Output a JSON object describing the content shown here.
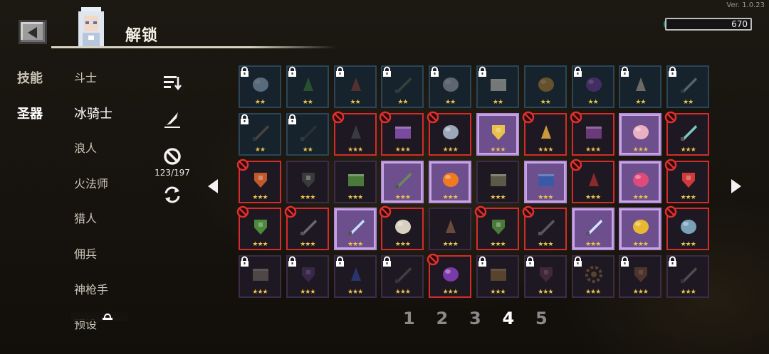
{
  "version": "Ver. 1.0.23",
  "header": {
    "title": "解锁",
    "currency_value": "670"
  },
  "left_tabs": [
    {
      "label": "技能",
      "active": false
    },
    {
      "label": "圣器",
      "active": true
    }
  ],
  "classes": [
    {
      "label": "斗士",
      "active": false
    },
    {
      "label": "冰骑士",
      "active": true
    },
    {
      "label": "浪人",
      "active": false
    },
    {
      "label": "火法师",
      "active": false
    },
    {
      "label": "猎人",
      "active": false
    },
    {
      "label": "佣兵",
      "active": false
    },
    {
      "label": "神枪手",
      "active": false
    },
    {
      "label": "预设",
      "active": false
    }
  ],
  "tools": {
    "count": "123/197"
  },
  "grid_icons": [
    [
      "crystal-icon",
      "green-stone-icon",
      "red-bag-icon",
      "dagger-icon",
      "orb-cluster-icon",
      "envelope-icon",
      "ring-icon",
      "dark-orb-icon",
      "shell-icon",
      "feather-icon"
    ],
    [
      "staff-icon",
      "whip-icon",
      "potion-icon",
      "spellbook-icon",
      "rock-icon",
      "dice-icon",
      "chalice-icon",
      "tome-icon",
      "brain-icon",
      "syringe-icon"
    ],
    [
      "shield-crest-icon",
      "cross-relic-icon",
      "leaf-scroll-icon",
      "rocket-icon",
      "fireball-icon",
      "map-icon",
      "battery-icon",
      "plant-icon",
      "egg-icon",
      "medkit-icon"
    ],
    [
      "goblin-mask-icon",
      "drill-icon",
      "ice-shard-icon",
      "moon-orb-icon",
      "feast-plate-icon",
      "cape-icon",
      "spear-icon",
      "lightning-icon",
      "gold-coin-icon",
      "cloud-icon"
    ],
    [
      "stone-tablet-icon",
      "shadow-wings-icon",
      "medal-icon",
      "scythe-icon",
      "dark-heart-icon",
      "treasure-chest-icon",
      "gauntlet-icon",
      "gear-wheel-icon",
      "pouch-icon",
      "crossbow-icon"
    ]
  ],
  "grid": [
    [
      {
        "tier": 2,
        "stars": "★★",
        "lock": true,
        "ban": false,
        "sel": false,
        "dim": true
      },
      {
        "tier": 2,
        "stars": "★★",
        "lock": true,
        "ban": false,
        "sel": false,
        "dim": true
      },
      {
        "tier": 2,
        "stars": "★★",
        "lock": true,
        "ban": false,
        "sel": false,
        "dim": true
      },
      {
        "tier": 2,
        "stars": "★★",
        "lock": true,
        "ban": false,
        "sel": false,
        "dim": true
      },
      {
        "tier": 2,
        "stars": "★★",
        "lock": true,
        "ban": false,
        "sel": false,
        "dim": true
      },
      {
        "tier": 2,
        "stars": "★★",
        "lock": true,
        "ban": false,
        "sel": false,
        "dim": true
      },
      {
        "tier": 2,
        "stars": "★★",
        "lock": false,
        "ban": false,
        "sel": false,
        "dim": true
      },
      {
        "tier": 2,
        "stars": "★★",
        "lock": true,
        "ban": false,
        "sel": false,
        "dim": true
      },
      {
        "tier": 2,
        "stars": "★★",
        "lock": true,
        "ban": false,
        "sel": false,
        "dim": true
      },
      {
        "tier": 2,
        "stars": "★★",
        "lock": true,
        "ban": false,
        "sel": false,
        "dim": true
      }
    ],
    [
      {
        "tier": 2,
        "stars": "★★",
        "lock": true,
        "ban": false,
        "sel": false,
        "dim": true
      },
      {
        "tier": 2,
        "stars": "★★",
        "lock": true,
        "ban": false,
        "sel": false,
        "dim": true
      },
      {
        "tier": 3,
        "stars": "★★★",
        "lock": false,
        "ban": true,
        "sel": false,
        "dim": false
      },
      {
        "tier": 3,
        "stars": "★★★",
        "lock": false,
        "ban": true,
        "sel": false,
        "dim": false
      },
      {
        "tier": 3,
        "stars": "★★★",
        "lock": false,
        "ban": true,
        "sel": false,
        "dim": false
      },
      {
        "tier": 3,
        "stars": "★★★",
        "lock": false,
        "ban": false,
        "sel": true,
        "dim": false
      },
      {
        "tier": 3,
        "stars": "★★★",
        "lock": false,
        "ban": true,
        "sel": false,
        "dim": false
      },
      {
        "tier": 3,
        "stars": "★★★",
        "lock": false,
        "ban": true,
        "sel": false,
        "dim": false
      },
      {
        "tier": 3,
        "stars": "★★★",
        "lock": false,
        "ban": false,
        "sel": true,
        "dim": false
      },
      {
        "tier": 3,
        "stars": "★★★",
        "lock": false,
        "ban": true,
        "sel": false,
        "dim": false
      }
    ],
    [
      {
        "tier": 3,
        "stars": "★★★",
        "lock": false,
        "ban": true,
        "sel": false,
        "dim": false
      },
      {
        "tier": 3,
        "stars": "★★★",
        "lock": false,
        "ban": false,
        "sel": false,
        "dim": false
      },
      {
        "tier": 3,
        "stars": "★★★",
        "lock": false,
        "ban": false,
        "sel": false,
        "dim": false
      },
      {
        "tier": 3,
        "stars": "★★★",
        "lock": false,
        "ban": false,
        "sel": true,
        "dim": false
      },
      {
        "tier": 3,
        "stars": "★★★",
        "lock": false,
        "ban": false,
        "sel": true,
        "dim": false
      },
      {
        "tier": 3,
        "stars": "★★★",
        "lock": false,
        "ban": false,
        "sel": false,
        "dim": false
      },
      {
        "tier": 3,
        "stars": "★★★",
        "lock": false,
        "ban": false,
        "sel": true,
        "dim": false
      },
      {
        "tier": 3,
        "stars": "★★★",
        "lock": false,
        "ban": true,
        "sel": false,
        "dim": false
      },
      {
        "tier": 3,
        "stars": "★★★",
        "lock": false,
        "ban": false,
        "sel": true,
        "dim": false
      },
      {
        "tier": 3,
        "stars": "★★★",
        "lock": false,
        "ban": true,
        "sel": false,
        "dim": false
      }
    ],
    [
      {
        "tier": 3,
        "stars": "★★★",
        "lock": false,
        "ban": true,
        "sel": false,
        "dim": false
      },
      {
        "tier": 3,
        "stars": "★★★",
        "lock": false,
        "ban": true,
        "sel": false,
        "dim": false
      },
      {
        "tier": 3,
        "stars": "★★★",
        "lock": false,
        "ban": false,
        "sel": true,
        "dim": false
      },
      {
        "tier": 3,
        "stars": "★★★",
        "lock": false,
        "ban": true,
        "sel": false,
        "dim": false
      },
      {
        "tier": 3,
        "stars": "★★★",
        "lock": false,
        "ban": false,
        "sel": false,
        "dim": false
      },
      {
        "tier": 3,
        "stars": "★★★",
        "lock": false,
        "ban": true,
        "sel": false,
        "dim": false
      },
      {
        "tier": 3,
        "stars": "★★★",
        "lock": false,
        "ban": true,
        "sel": false,
        "dim": false
      },
      {
        "tier": 3,
        "stars": "★★★",
        "lock": false,
        "ban": false,
        "sel": true,
        "dim": false
      },
      {
        "tier": 3,
        "stars": "★★★",
        "lock": false,
        "ban": false,
        "sel": true,
        "dim": false
      },
      {
        "tier": 3,
        "stars": "★★★",
        "lock": false,
        "ban": true,
        "sel": false,
        "dim": false
      }
    ],
    [
      {
        "tier": 3,
        "stars": "★★★",
        "lock": true,
        "ban": false,
        "sel": false,
        "dim": true
      },
      {
        "tier": 3,
        "stars": "★★★",
        "lock": true,
        "ban": false,
        "sel": false,
        "dim": true
      },
      {
        "tier": 3,
        "stars": "★★★",
        "lock": true,
        "ban": false,
        "sel": false,
        "dim": true
      },
      {
        "tier": 3,
        "stars": "★★★",
        "lock": true,
        "ban": false,
        "sel": false,
        "dim": true
      },
      {
        "tier": 3,
        "stars": "★★★",
        "lock": false,
        "ban": true,
        "sel": false,
        "dim": false
      },
      {
        "tier": 3,
        "stars": "★★★",
        "lock": true,
        "ban": false,
        "sel": false,
        "dim": true
      },
      {
        "tier": 3,
        "stars": "★★★",
        "lock": true,
        "ban": false,
        "sel": false,
        "dim": true
      },
      {
        "tier": 3,
        "stars": "★★★",
        "lock": true,
        "ban": false,
        "sel": false,
        "dim": true
      },
      {
        "tier": 3,
        "stars": "★★★",
        "lock": true,
        "ban": false,
        "sel": false,
        "dim": true
      },
      {
        "tier": 3,
        "stars": "★★★",
        "lock": true,
        "ban": false,
        "sel": false,
        "dim": true
      }
    ]
  ],
  "pager": {
    "pages": [
      "1",
      "2",
      "3",
      "4",
      "5"
    ],
    "active_index": 3
  },
  "colors": {
    "ban": "#d42c2c",
    "selected": "#6e4f8e",
    "star": "#e8c24a"
  }
}
